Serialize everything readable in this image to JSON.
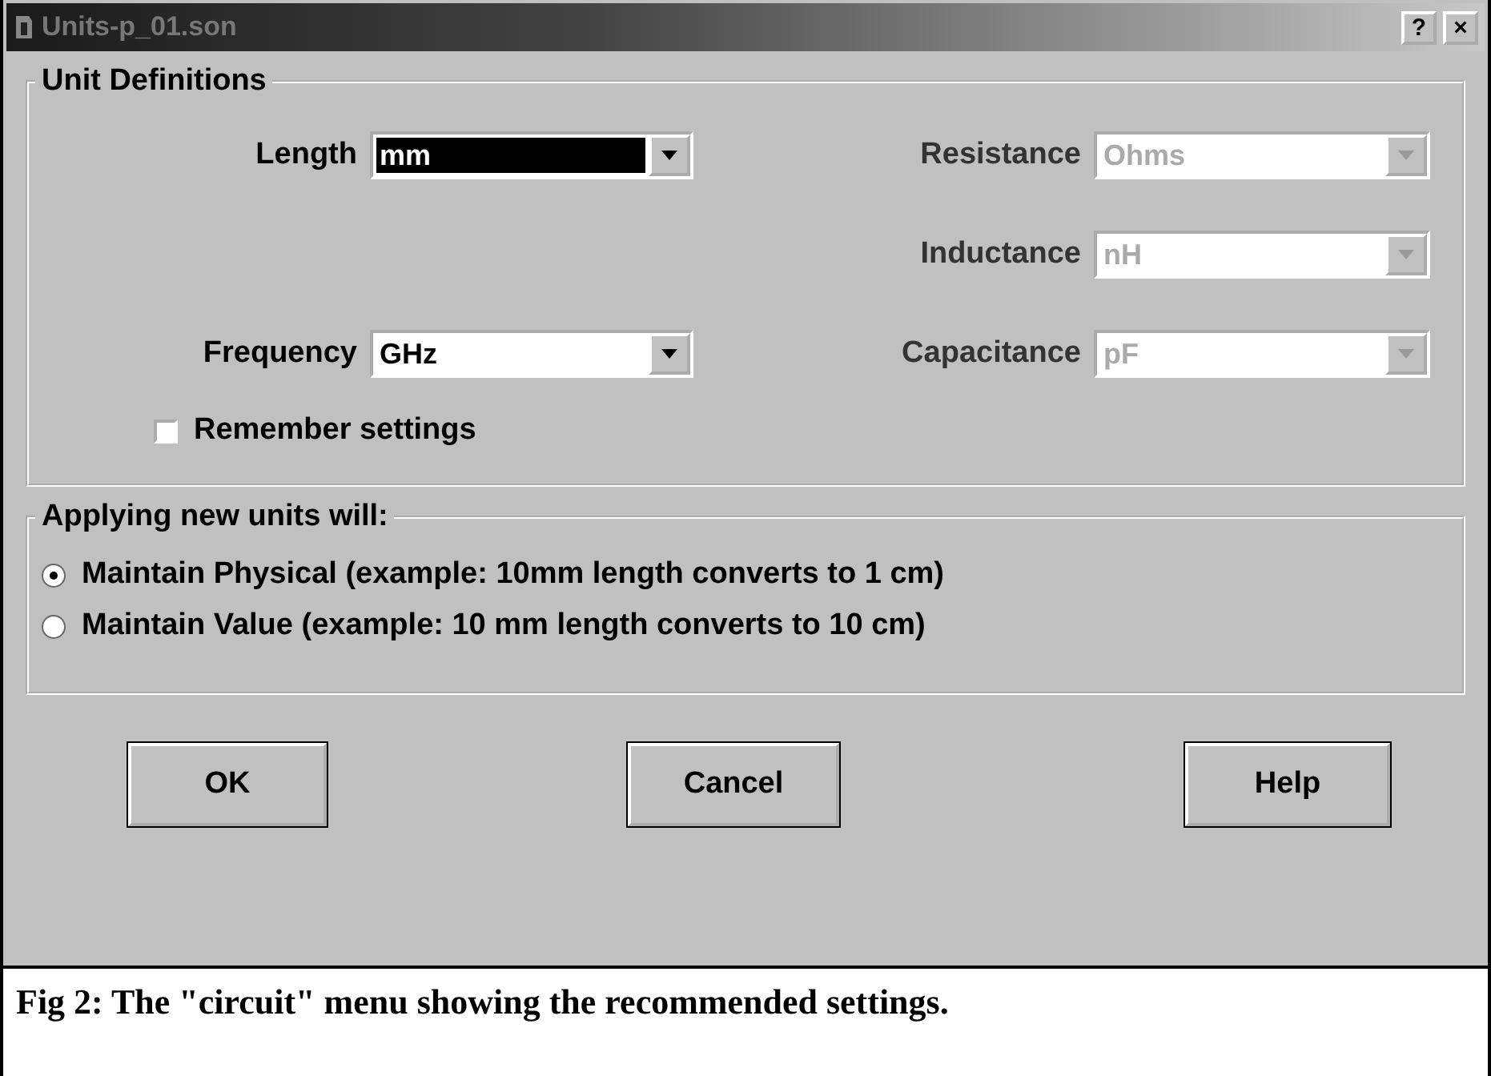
{
  "window": {
    "title": "Units-p_01.son",
    "help_button": "?",
    "close_button": "×"
  },
  "unit_definitions": {
    "title": "Unit Definitions",
    "rows": [
      {
        "left": {
          "label": "Length",
          "value": "mm",
          "disabled": false,
          "highlighted": true
        },
        "right": {
          "label": "Resistance",
          "value": "Ohms",
          "disabled": true,
          "highlighted": false
        }
      },
      {
        "right": {
          "label": "Inductance",
          "value": "nH",
          "disabled": true,
          "highlighted": false
        }
      },
      {
        "left": {
          "label": "Frequency",
          "value": "GHz",
          "disabled": false,
          "highlighted": false
        },
        "right": {
          "label": "Capacitance",
          "value": "pF",
          "disabled": true,
          "highlighted": false
        }
      }
    ],
    "remember": {
      "label": "Remember settings",
      "checked": false
    }
  },
  "applying": {
    "title": "Applying new units will:",
    "options": [
      {
        "label": "Maintain Physical (example: 10mm length converts to 1 cm)",
        "selected": true
      },
      {
        "label": "Maintain Value (example: 10 mm length converts to 10 cm)",
        "selected": false
      }
    ]
  },
  "buttons": [
    "OK",
    "Cancel",
    "Help"
  ],
  "caption": "Fig 2: The \"circuit\" menu showing the recommended settings."
}
